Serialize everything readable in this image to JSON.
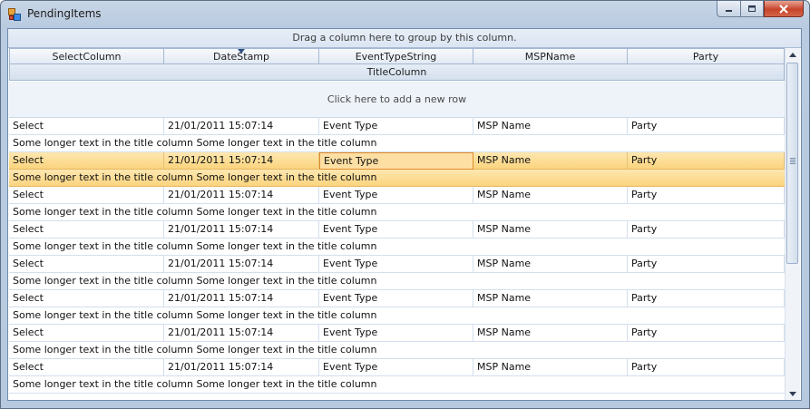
{
  "window": {
    "title": "PendingItems"
  },
  "grid": {
    "group_panel_text": "Drag a column here to group by this column.",
    "columns": [
      "SelectColumn",
      "DateStamp",
      "EventTypeString",
      "MSPName",
      "Party"
    ],
    "sorted_column": "DateStamp",
    "title_column_header": "TitleColumn",
    "new_row_text": "Click here to add a new row",
    "rows": [
      {
        "select": "Select",
        "date": "21/01/2011 15:07:14",
        "event": "Event Type",
        "msp": "MSP Name",
        "party": "Party",
        "title": "Some longer text in the title column Some longer text in the title column",
        "selected": false
      },
      {
        "select": "Select",
        "date": "21/01/2011 15:07:14",
        "event": "Event Type",
        "msp": "MSP Name",
        "party": "Party",
        "title": "Some longer text in the title column Some longer text in the title column",
        "selected": true
      },
      {
        "select": "Select",
        "date": "21/01/2011 15:07:14",
        "event": "Event Type",
        "msp": "MSP Name",
        "party": "Party",
        "title": "Some longer text in the title column Some longer text in the title column",
        "selected": false
      },
      {
        "select": "Select",
        "date": "21/01/2011 15:07:14",
        "event": "Event Type",
        "msp": "MSP Name",
        "party": "Party",
        "title": "Some longer text in the title column Some longer text in the title column",
        "selected": false
      },
      {
        "select": "Select",
        "date": "21/01/2011 15:07:14",
        "event": "Event Type",
        "msp": "MSP Name",
        "party": "Party",
        "title": "Some longer text in the title column Some longer text in the title column",
        "selected": false
      },
      {
        "select": "Select",
        "date": "21/01/2011 15:07:14",
        "event": "Event Type",
        "msp": "MSP Name",
        "party": "Party",
        "title": "Some longer text in the title column Some longer text in the title column",
        "selected": false
      },
      {
        "select": "Select",
        "date": "21/01/2011 15:07:14",
        "event": "Event Type",
        "msp": "MSP Name",
        "party": "Party",
        "title": "Some longer text in the title column Some longer text in the title column",
        "selected": false
      },
      {
        "select": "Select",
        "date": "21/01/2011 15:07:14",
        "event": "Event Type",
        "msp": "MSP Name",
        "party": "Party",
        "title": "Some longer text in the title column Some longer text in the title column",
        "selected": false
      }
    ]
  },
  "colors": {
    "selection": "#fbd47e",
    "current_cell_border": "#e08b2a",
    "header": "#e3eaf4",
    "close_button": "#c7442a"
  },
  "icons": {
    "app": "pending-items-app-icon",
    "minimize": "minimize-icon",
    "maximize": "maximize-icon",
    "close": "close-icon",
    "scroll_up": "scroll-up-arrow-icon",
    "scroll_down": "scroll-down-arrow-icon"
  }
}
